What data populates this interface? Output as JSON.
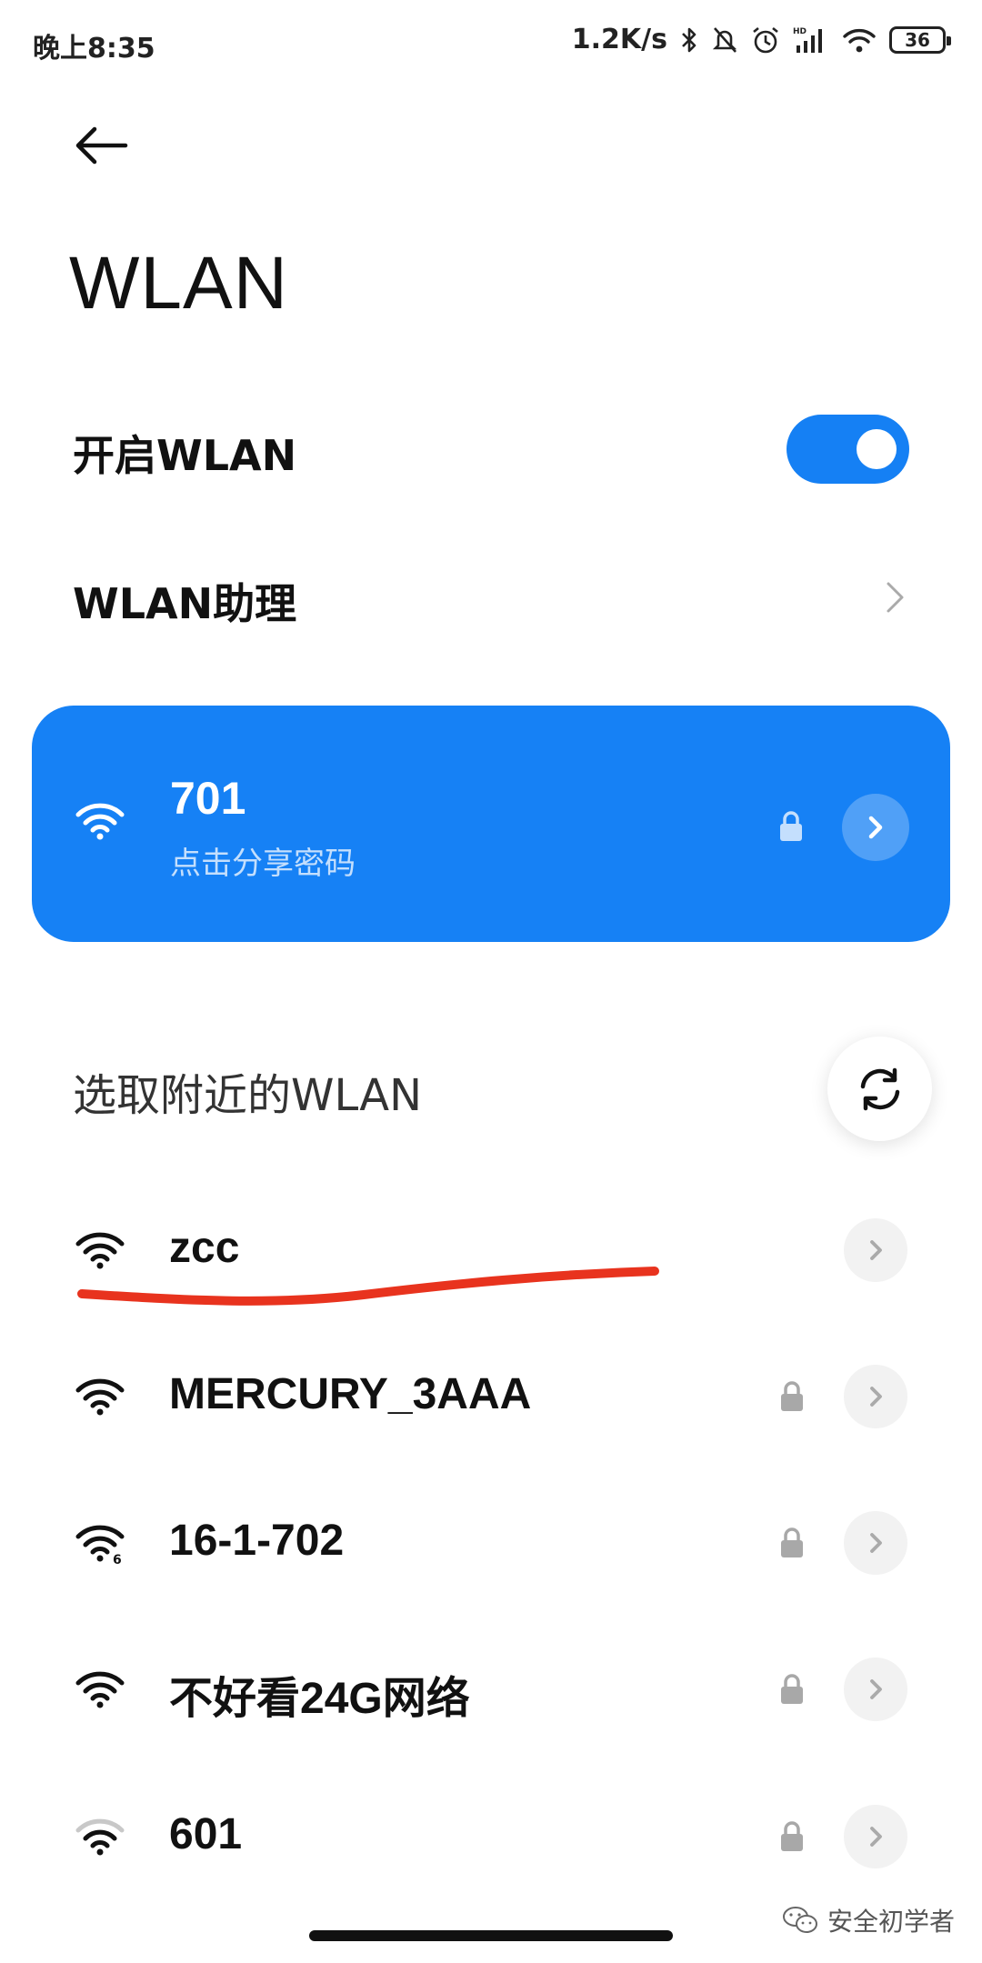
{
  "status_bar": {
    "time": "晚上8:35",
    "speed": "1.2K/s",
    "network_tag": "HD",
    "battery": "36"
  },
  "header": {
    "title": "WLAN"
  },
  "settings": {
    "enable_label": "开启WLAN",
    "enable_state": "on",
    "assistant_label": "WLAN助理"
  },
  "connected": {
    "ssid": "701",
    "subtitle": "点击分享密码",
    "locked": true
  },
  "nearby": {
    "title": "选取附近的WLAN",
    "networks": [
      {
        "ssid": "zcc",
        "locked": false,
        "signal": "full"
      },
      {
        "ssid": "MERCURY_3AAA",
        "locked": true,
        "signal": "full"
      },
      {
        "ssid": "16-1-702",
        "locked": true,
        "signal": "full",
        "badge": "6"
      },
      {
        "ssid": "不好看24G网络",
        "locked": true,
        "signal": "full"
      },
      {
        "ssid": "601",
        "locked": true,
        "signal": "weak"
      }
    ]
  },
  "watermark": "安全初学者",
  "colors": {
    "accent": "#1681f5",
    "annotation": "#e8331e"
  }
}
